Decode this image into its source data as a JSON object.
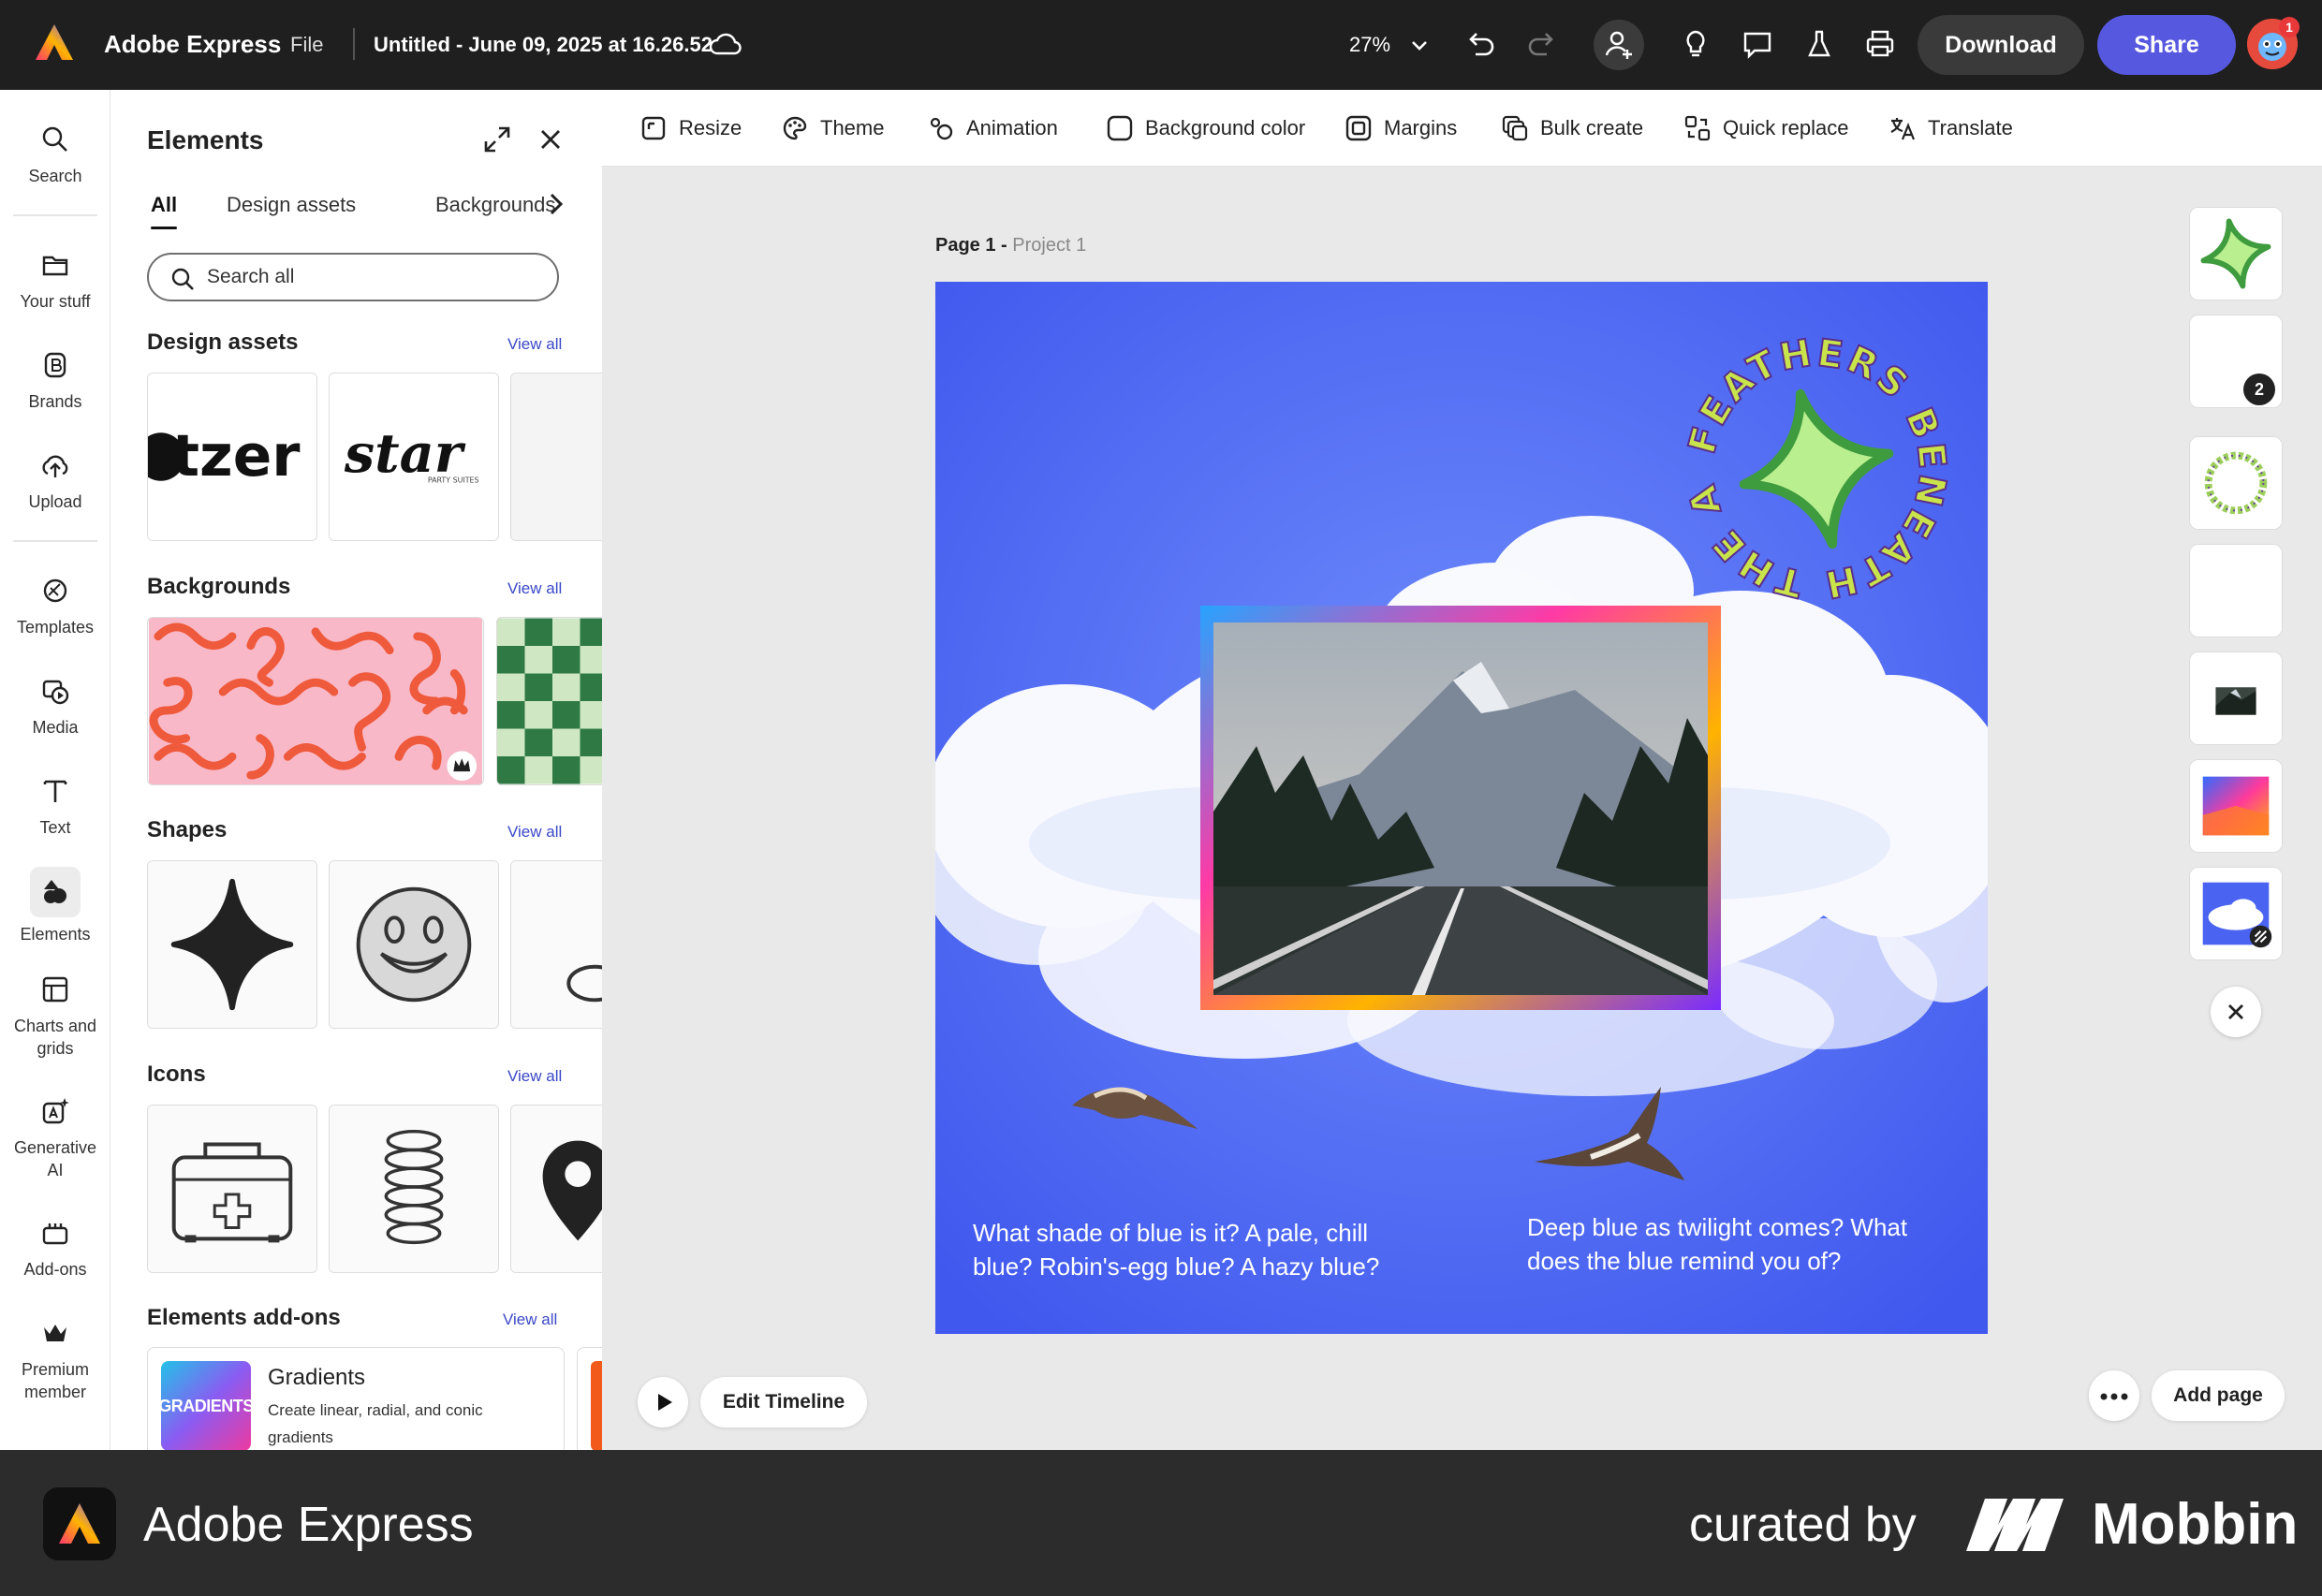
{
  "topbar": {
    "app_name": "Adobe Express",
    "file_menu": "File",
    "doc_title": "Untitled - June 09, 2025 at 16.26.52",
    "zoom": "27%",
    "download": "Download",
    "share": "Share",
    "notification_count": "1",
    "colors": {
      "bar": "#1f1f1f",
      "share": "#5758e0"
    }
  },
  "rail": {
    "items": [
      {
        "label": "Search",
        "icon": "search-icon"
      },
      {
        "label": "Your stuff",
        "icon": "folder-icon"
      },
      {
        "label": "Brands",
        "icon": "brand-icon"
      },
      {
        "label": "Upload",
        "icon": "upload-cloud-icon"
      },
      {
        "label": "Templates",
        "icon": "templates-icon"
      },
      {
        "label": "Media",
        "icon": "media-icon"
      },
      {
        "label": "Text",
        "icon": "text-icon"
      },
      {
        "label": "Elements",
        "icon": "elements-icon"
      },
      {
        "label": "Charts and",
        "label2": "grids",
        "icon": "chart-grid-icon"
      },
      {
        "label": "Generative",
        "label2": "AI",
        "icon": "generative-ai-icon"
      },
      {
        "label": "Add-ons",
        "icon": "add-ons-icon"
      },
      {
        "label": "Premium",
        "label2": "member",
        "icon": "crown-icon"
      }
    ]
  },
  "panel": {
    "title": "Elements",
    "tabs": [
      "All",
      "Design assets",
      "Backgrounds"
    ],
    "search_placeholder": "Search all",
    "sections": {
      "design_assets": "Design assets",
      "backgrounds": "Backgrounds",
      "shapes": "Shapes",
      "icons": "Icons",
      "addons": "Elements add-ons"
    },
    "view_all": "View all",
    "asset_texts": [
      "tzer",
      "star",
      "PARTY SUITES"
    ],
    "addon": {
      "thumb_text": "GRADIENTS",
      "name": "Gradients",
      "desc": "Create linear, radial, and conic gradients"
    }
  },
  "toolbar": {
    "items": [
      "Resize",
      "Theme",
      "Animation",
      "Background color",
      "Margins",
      "Bulk create",
      "Quick replace",
      "Translate"
    ]
  },
  "canvas": {
    "page": "Page 1 -",
    "project": "Project 1",
    "circle_text": "FEATHERS BENEATH THE AZURE",
    "caption_left": [
      "What shade of blue is it? A pale, chill",
      "blue? Robin's-egg blue? A hazy blue?"
    ],
    "caption_right": [
      "Deep blue as twilight comes? What",
      "does the blue remind you of?"
    ],
    "edit_timeline": "Edit Timeline",
    "add_page": "Add page",
    "colors": {
      "background": "#4a63f0"
    }
  },
  "layers": {
    "badge": "2"
  },
  "footer": {
    "app_name": "Adobe Express",
    "curated_by": "curated by",
    "brand": "Mobbin"
  }
}
